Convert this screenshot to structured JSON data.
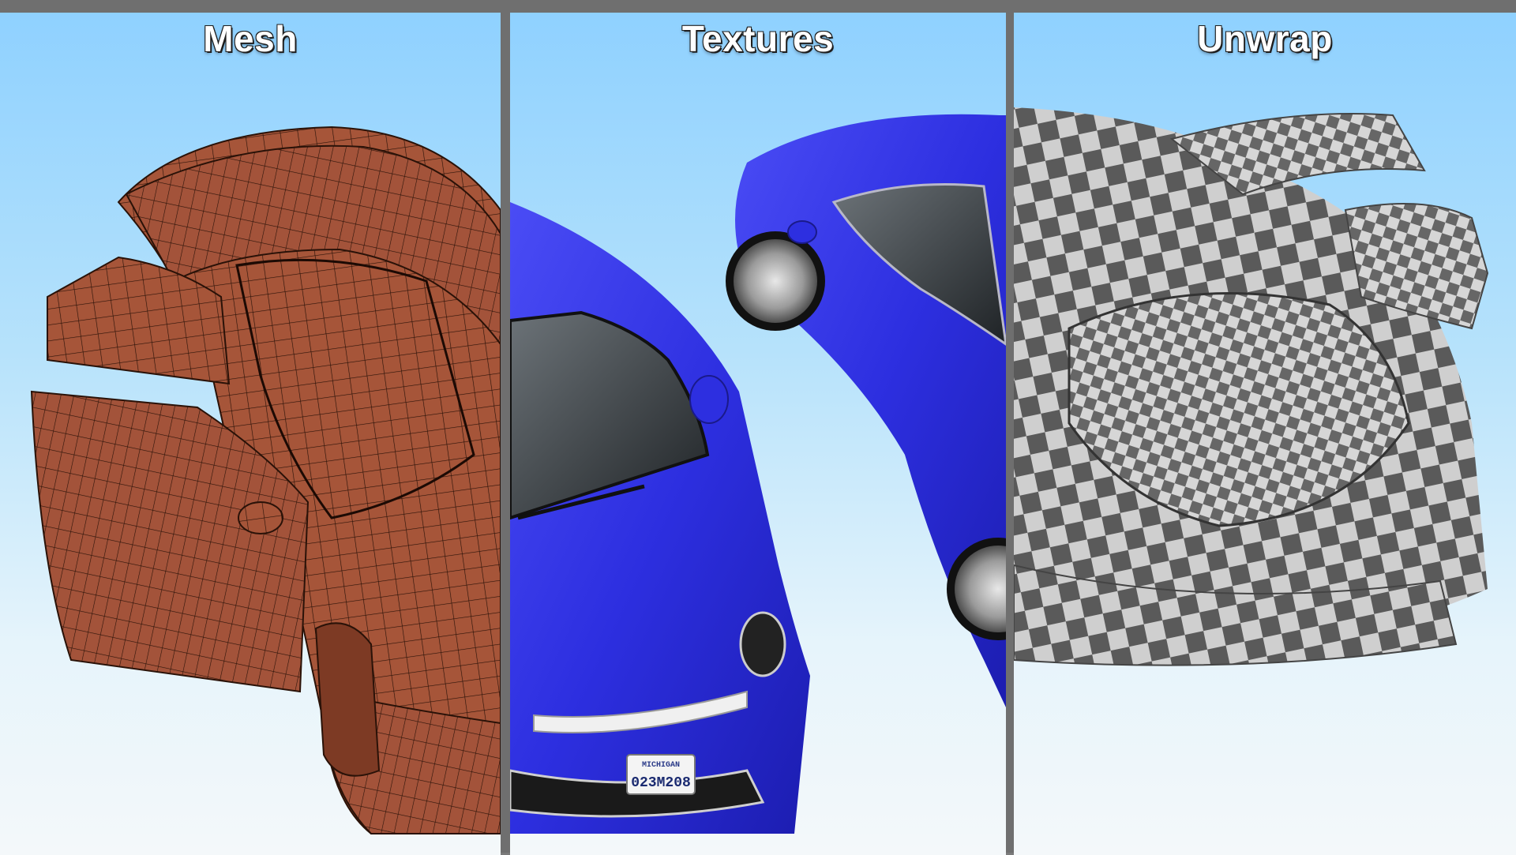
{
  "panels": [
    {
      "id": "mesh",
      "title": "Mesh"
    },
    {
      "id": "textures",
      "title": "Textures"
    },
    {
      "id": "unwrap",
      "title": "Unwrap"
    }
  ],
  "license_plate": {
    "state": "MICHIGAN",
    "number": "023M208"
  },
  "colors": {
    "sky_top": "#8fd1ff",
    "sky_bottom": "#f4f8fa",
    "mesh_body": "#a65539",
    "mesh_wire": "#2a1208",
    "car_blue": "#2d2fe0",
    "checker_dark": "#5a5a5a",
    "checker_light": "#cfcfcf",
    "divider": "#6f6f6f"
  }
}
